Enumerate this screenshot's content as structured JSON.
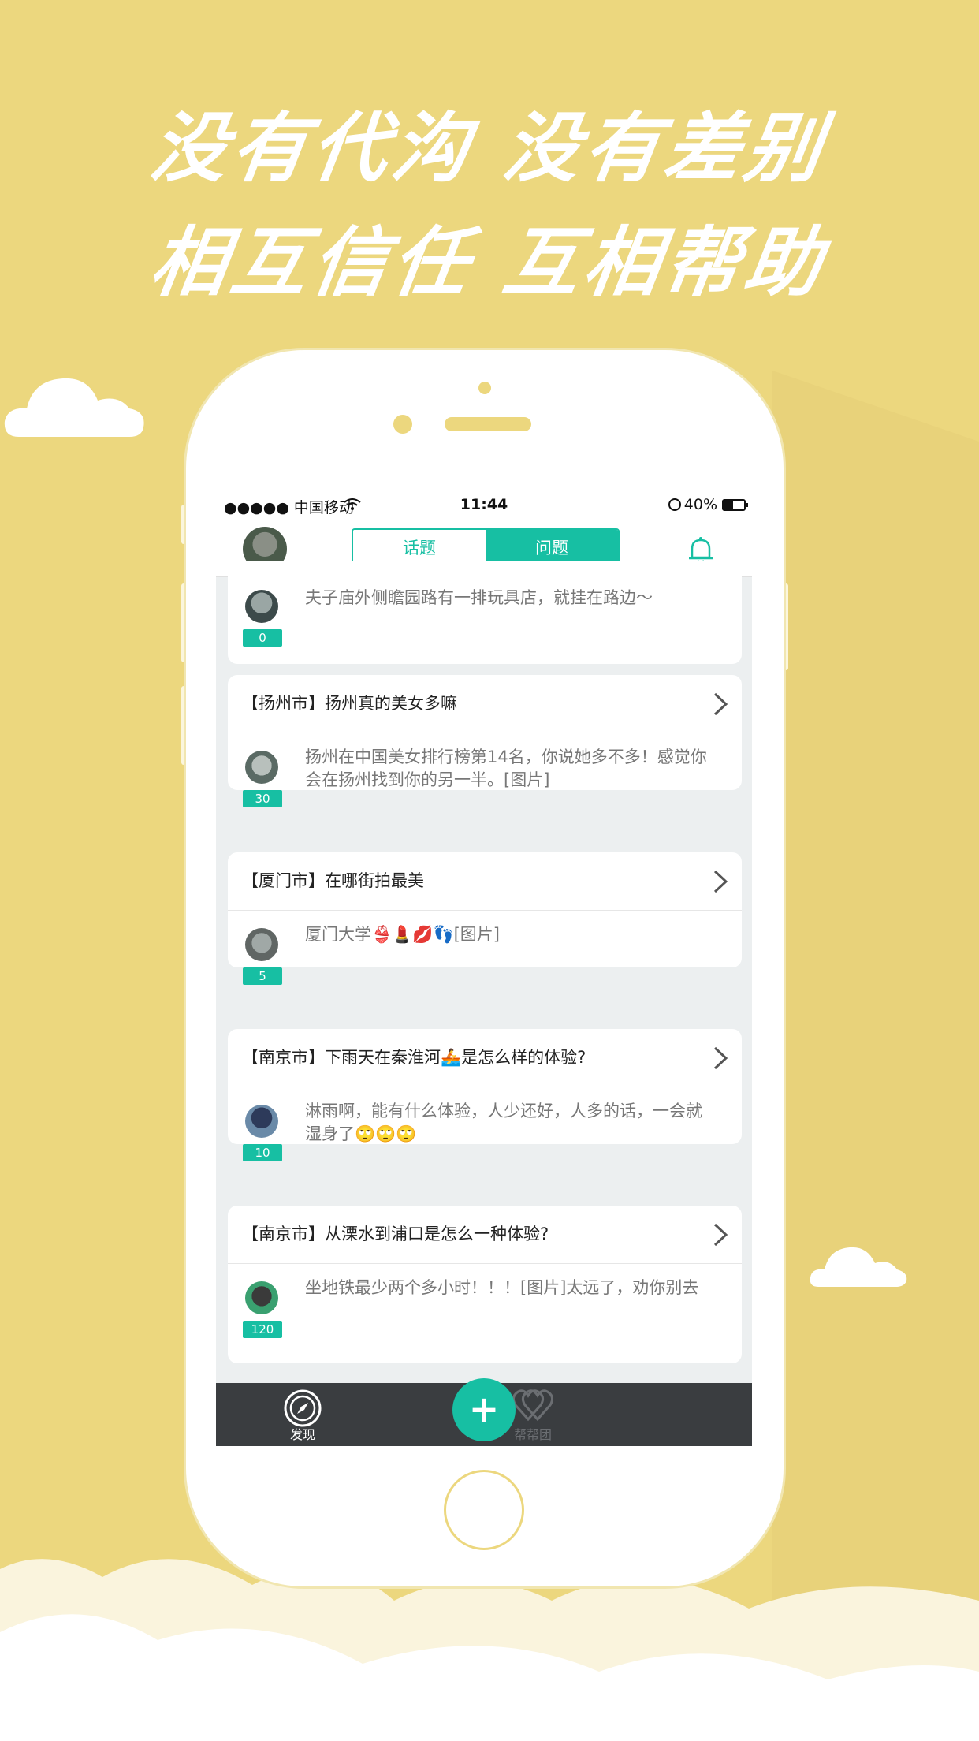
{
  "headline": {
    "line1": "没有代沟 没有差别",
    "line2": "相互信任 互相帮助"
  },
  "status_bar": {
    "carrier": "●●●●● 中国移动",
    "time": "11:44",
    "battery": "40%"
  },
  "nav": {
    "tabs": [
      {
        "label": "话题",
        "active": false
      },
      {
        "label": "问题",
        "active": true
      }
    ]
  },
  "feed": {
    "first_answer": {
      "text": "夫子庙外侧瞻园路有一排玩具店，就挂在路边～",
      "count": "0"
    },
    "cards": [
      {
        "title": "【扬州市】扬州真的美女多嘛",
        "answer": "扬州在中国美女排行榜第14名，你说她多不多！感觉你会在扬州找到你的另一半。[图片]",
        "count": "30"
      },
      {
        "title": "【厦门市】在哪街拍最美",
        "answer": "厦门大学👙💄💋👣[图片]",
        "count": "5"
      },
      {
        "title": "【南京市】下雨天在秦淮河🚣是怎么样的体验?",
        "answer": "淋雨啊，能有什么体验，人少还好，人多的话，一会就湿身了🙄🙄🙄",
        "count": "10"
      },
      {
        "title": "【南京市】从溧水到浦口是怎么一种体验?",
        "answer": "坐地铁最少两个多小时！！！[图片]太远了，劝你别去",
        "count": "120"
      }
    ]
  },
  "tabbar": {
    "discover": "发现",
    "add": "+",
    "help_group": "帮帮团"
  },
  "colors": {
    "background": "#ecd77e",
    "accent": "#17bfa3",
    "tabbar": "#3a3d40"
  },
  "icons": [
    "compass-icon",
    "bell-icon",
    "chevron-right-icon",
    "plus-icon",
    "hearts-icon",
    "wifi-icon",
    "lock-icon"
  ]
}
